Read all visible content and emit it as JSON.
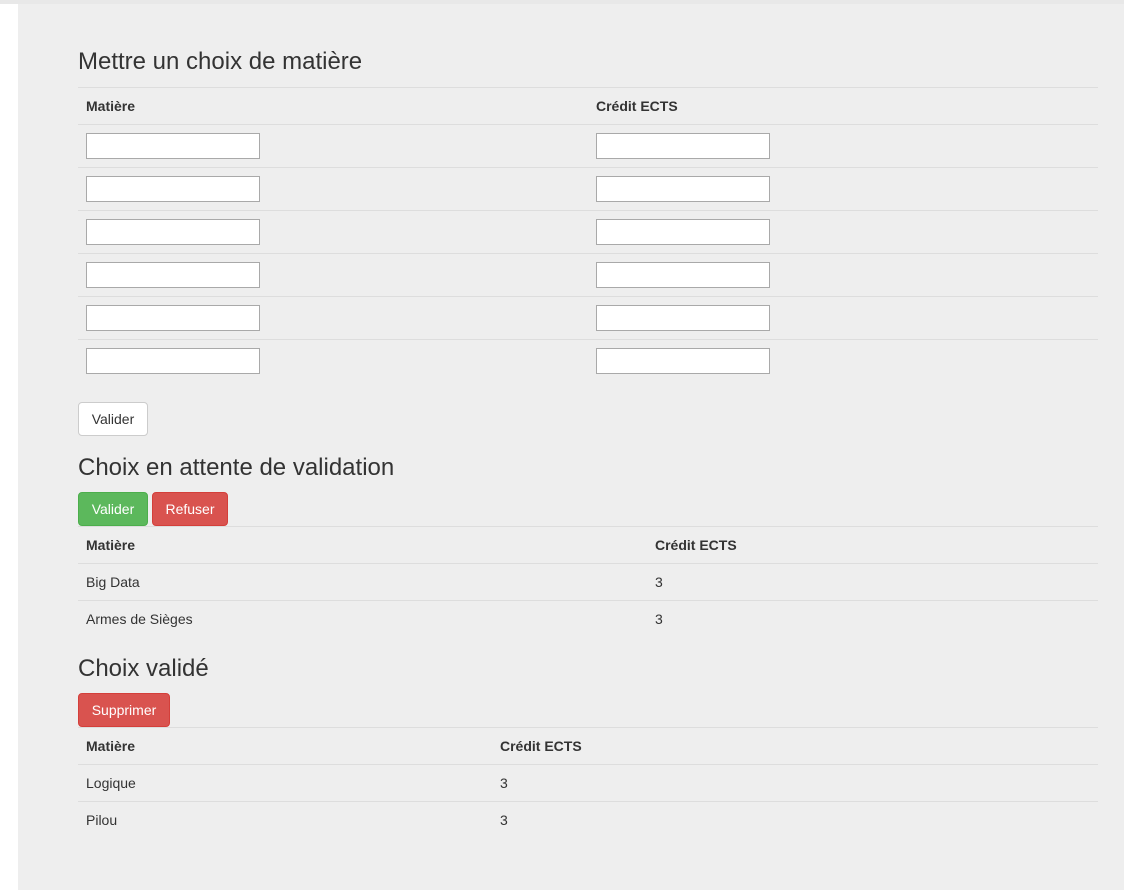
{
  "form_section": {
    "title": "Mettre un choix de matière",
    "col_subject": "Matière",
    "col_credit": "Crédit ECTS",
    "rows": [
      {
        "subject": "",
        "credit": ""
      },
      {
        "subject": "",
        "credit": ""
      },
      {
        "subject": "",
        "credit": ""
      },
      {
        "subject": "",
        "credit": ""
      },
      {
        "subject": "",
        "credit": ""
      },
      {
        "subject": "",
        "credit": ""
      }
    ],
    "submit_label": "Valider"
  },
  "pending_section": {
    "title": "Choix en attente de validation",
    "validate_label": "Valider",
    "refuse_label": "Refuser",
    "col_subject": "Matière",
    "col_credit": "Crédit ECTS",
    "rows": [
      {
        "subject": "Big Data",
        "credit": "3"
      },
      {
        "subject": "Armes de Sièges",
        "credit": "3"
      }
    ]
  },
  "validated_section": {
    "title": "Choix validé",
    "delete_label": "Supprimer",
    "col_subject": "Matière",
    "col_credit": "Crédit ECTS",
    "rows": [
      {
        "subject": "Logique",
        "credit": "3"
      },
      {
        "subject": "Pilou",
        "credit": "3"
      }
    ]
  },
  "colors": {
    "success": "#5cb85c",
    "danger": "#d9534f",
    "panel_bg": "#eeeeee"
  }
}
